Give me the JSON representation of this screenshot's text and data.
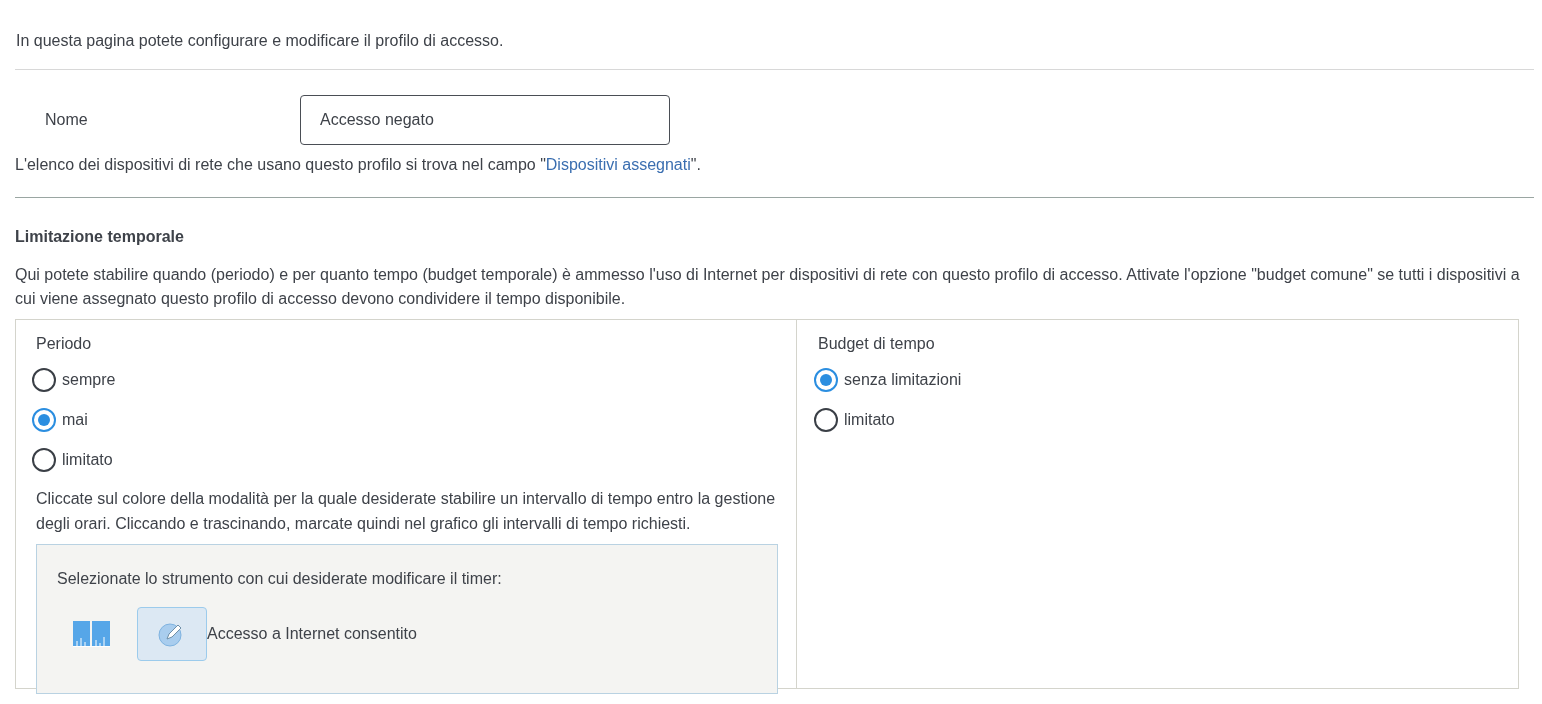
{
  "intro": "In questa pagina potete configurare e modificare il profilo di accesso.",
  "name_field": {
    "label": "Nome",
    "value": "Accesso negato"
  },
  "assigned_note": {
    "before": "L'elenco dei dispositivi di rete che usano questo profilo si trova nel campo \"",
    "link": "Dispositivi assegnati",
    "after": "\"."
  },
  "time_limit": {
    "heading": "Limitazione temporale",
    "description": "Qui potete stabilire quando (periodo) e per quanto tempo (budget temporale) è ammesso l'uso di Internet per dispositivi di rete con questo profilo di accesso. Attivate l'opzione \"budget comune\" se tutti i dispositivi a cui viene assegnato questo profilo di accesso devono condividere il tempo disponibile.",
    "period": {
      "title": "Periodo",
      "options": [
        {
          "label": "sempre",
          "selected": false
        },
        {
          "label": "mai",
          "selected": true
        },
        {
          "label": "limitato",
          "selected": false
        }
      ],
      "hint": "Cliccate sul colore della modalità per la quale desiderate stabilire un intervallo di tempo entro la gestione degli orari. Cliccando e trascinando, marcate quindi nel grafico gli intervalli di tempo richiesti.",
      "tool_panel": {
        "prompt": "Selezionate lo strumento con cui desiderate modificare il timer:",
        "tool_label": "Accesso a Internet consentito"
      }
    },
    "budget": {
      "title": "Budget di tempo",
      "options": [
        {
          "label": "senza limitazioni",
          "selected": true
        },
        {
          "label": "limitato",
          "selected": false
        }
      ]
    }
  }
}
